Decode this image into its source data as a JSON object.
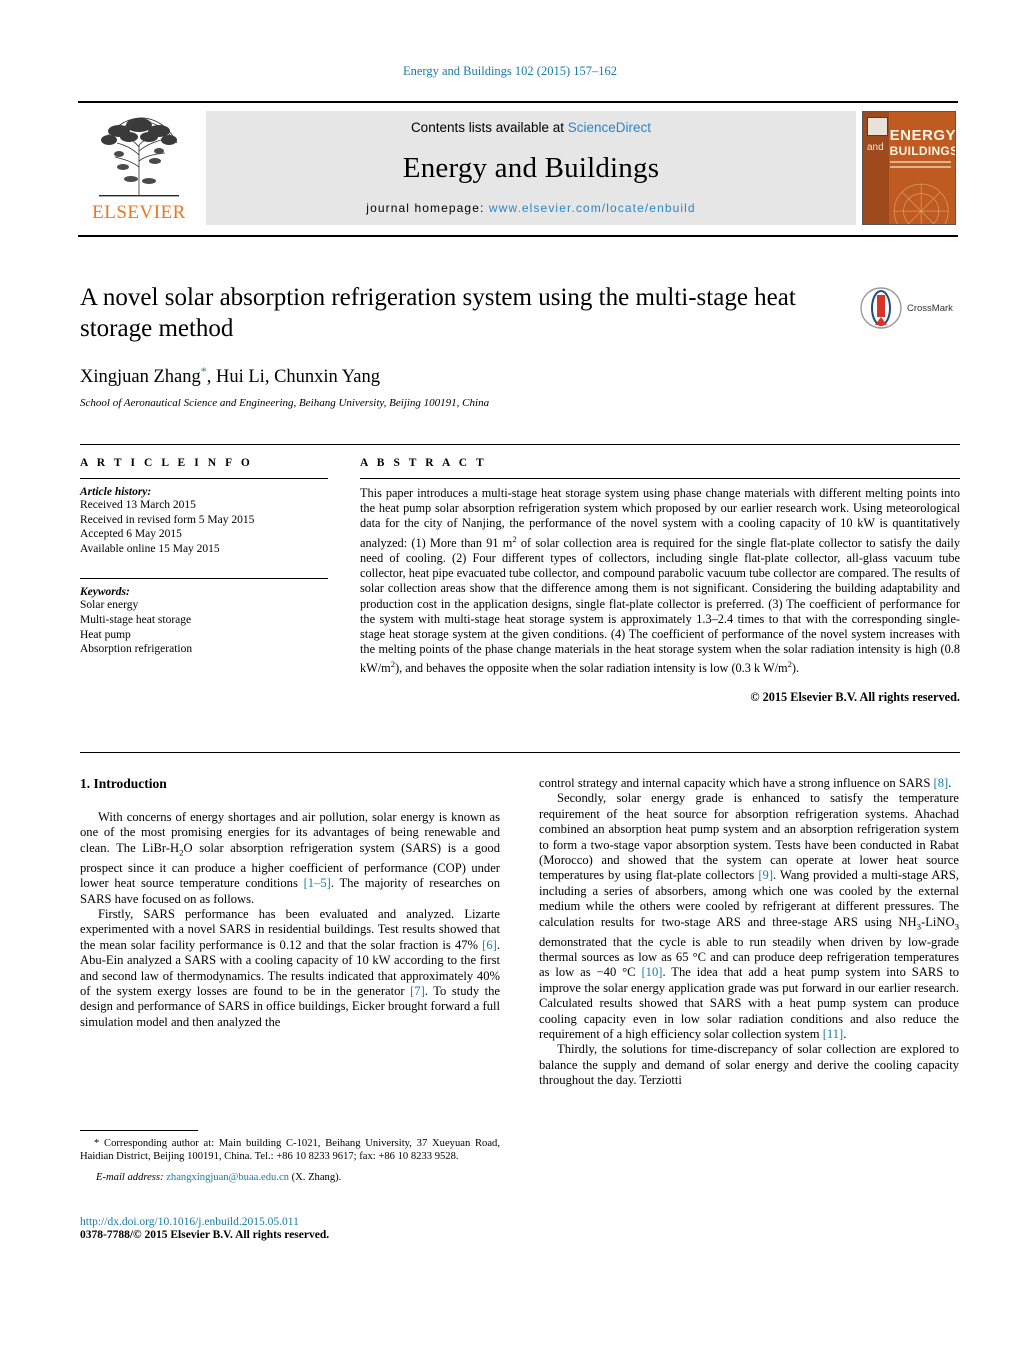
{
  "journal_ref": "Energy and Buildings 102 (2015) 157–162",
  "masthead": {
    "publisher_name": "ELSEVIER",
    "contents_prefix": "Contents lists available at ",
    "contents_link": "ScienceDirect",
    "journal_title": "Energy and Buildings",
    "homepage_prefix": "journal homepage: ",
    "homepage_url": "www.elsevier.com/locate/enbuild",
    "cover": {
      "and": "and",
      "energy": "ENERGY",
      "buildings": "BUILDINGS"
    }
  },
  "article": {
    "title": "A novel solar absorption refrigeration system using the multi-stage heat storage method",
    "authors": "Xingjuan Zhang, Hui Li, Chunxin Yang",
    "author_marker": "*",
    "affiliation": "School of Aeronautical Science and Engineering, Beihang University, Beijing 100191, China",
    "crossmark_label": "CrossMark"
  },
  "article_info": {
    "heading": "A R T I C L E   I N F O",
    "history_label": "Article history:",
    "history": [
      "Received 13 March 2015",
      "Received in revised form 5 May 2015",
      "Accepted 6 May 2015",
      "Available online 15 May 2015"
    ],
    "keywords_label": "Keywords:",
    "keywords": [
      "Solar energy",
      "Multi-stage heat storage",
      "Heat pump",
      "Absorption refrigeration"
    ]
  },
  "abstract": {
    "heading": "A B S T R A C T",
    "text": "This paper introduces a multi-stage heat storage system using phase change materials with different melting points into the heat pump solar absorption refrigeration system which proposed by our earlier research work. Using meteorological data for the city of Nanjing, the performance of the novel system with a cooling capacity of 10 kW is quantitatively analyzed: (1) More than 91 m² of solar collection area is required for the single flat-plate collector to satisfy the daily need of cooling. (2) Four different types of collectors, including single flat-plate collector, all-glass vacuum tube collector, heat pipe evacuated tube collector, and compound parabolic vacuum tube collector are compared. The results of solar collection areas show that the difference among them is not significant. Considering the building adaptability and production cost in the application designs, single flat-plate collector is preferred. (3) The coefficient of performance for the system with multi-stage heat storage system is approximately 1.3–2.4 times to that with the corresponding single-stage heat storage system at the given conditions. (4) The coefficient of performance of the novel system increases with the melting points of the phase change materials in the heat storage system when the solar radiation intensity is high (0.8 kW/m²), and behaves the opposite when the solar radiation intensity is low (0.3 k W/m²).",
    "copyright": "© 2015 Elsevier B.V. All rights reserved."
  },
  "introduction": {
    "heading": "1.  Introduction",
    "left_paragraphs": [
      "With concerns of energy shortages and air pollution, solar energy is known as one of the most promising energies for its advantages of being renewable and clean. The LiBr-H2O solar absorption refrigeration system (SARS) is a good prospect since it can produce a higher coefficient of performance (COP) under lower heat source temperature conditions [1–5]. The majority of researches on SARS have focused on as follows.",
      "Firstly, SARS performance has been evaluated and analyzed. Lizarte experimented with a novel SARS in residential buildings. Test results showed that the mean solar facility performance is 0.12 and that the solar fraction is 47% [6]. Abu-Ein analyzed a SARS with a cooling capacity of 10 kW according to the first and second law of thermodynamics. The results indicated that approximately 40% of the system exergy losses are found to be in the generator [7]. To study the design and performance of SARS in office buildings, Eicker brought forward a full simulation model and then analyzed the"
    ],
    "right_paragraphs": [
      "control strategy and internal capacity which have a strong influence on SARS [8].",
      "Secondly, solar energy grade is enhanced to satisfy the temperature requirement of the heat source for absorption refrigeration systems. Ahachad combined an absorption heat pump system and an absorption refrigeration system to form a two-stage vapor absorption system. Tests have been conducted in Rabat (Morocco) and showed that the system can operate at lower heat source temperatures by using flat-plate collectors [9]. Wang provided a multi-stage ARS, including a series of absorbers, among which one was cooled by the external medium while the others were cooled by refrigerant at different pressures. The calculation results for two-stage ARS and three-stage ARS using NH3-LiNO3 demonstrated that the cycle is able to run steadily when driven by low-grade thermal sources as low as 65 °C and can produce deep refrigeration temperatures as low as −40 °C [10]. The idea that add a heat pump system into SARS to improve the solar energy application grade was put forward in our earlier research. Calculated results showed that SARS with a heat pump system can produce cooling capacity even in low solar radiation conditions and also reduce the requirement of a high efficiency solar collection system [11].",
      "Thirdly, the solutions for time-discrepancy of solar collection are explored to balance the supply and demand of solar energy and derive the cooling capacity throughout the day. Terziotti"
    ]
  },
  "footnote": {
    "text": "* Corresponding author at: Main building C-1021, Beihang University, 37 Xueyuan Road, Haidian District, Beijing 100191, China. Tel.: +86 10 8233 9617; fax: +86 10 8233 9528.",
    "email_label": "E-mail address:",
    "email": "zhangxingjuan@buaa.edu.cn",
    "email_suffix": "(X. Zhang)."
  },
  "footer": {
    "doi": "http://dx.doi.org/10.1016/j.enbuild.2015.05.011",
    "issn": "0378-7788/© 2015 Elsevier B.V. All rights reserved."
  },
  "colors": {
    "link": "#1a7aa8",
    "elsevier_orange": "#E87722",
    "sciencedirect_blue": "#2a86c8"
  }
}
